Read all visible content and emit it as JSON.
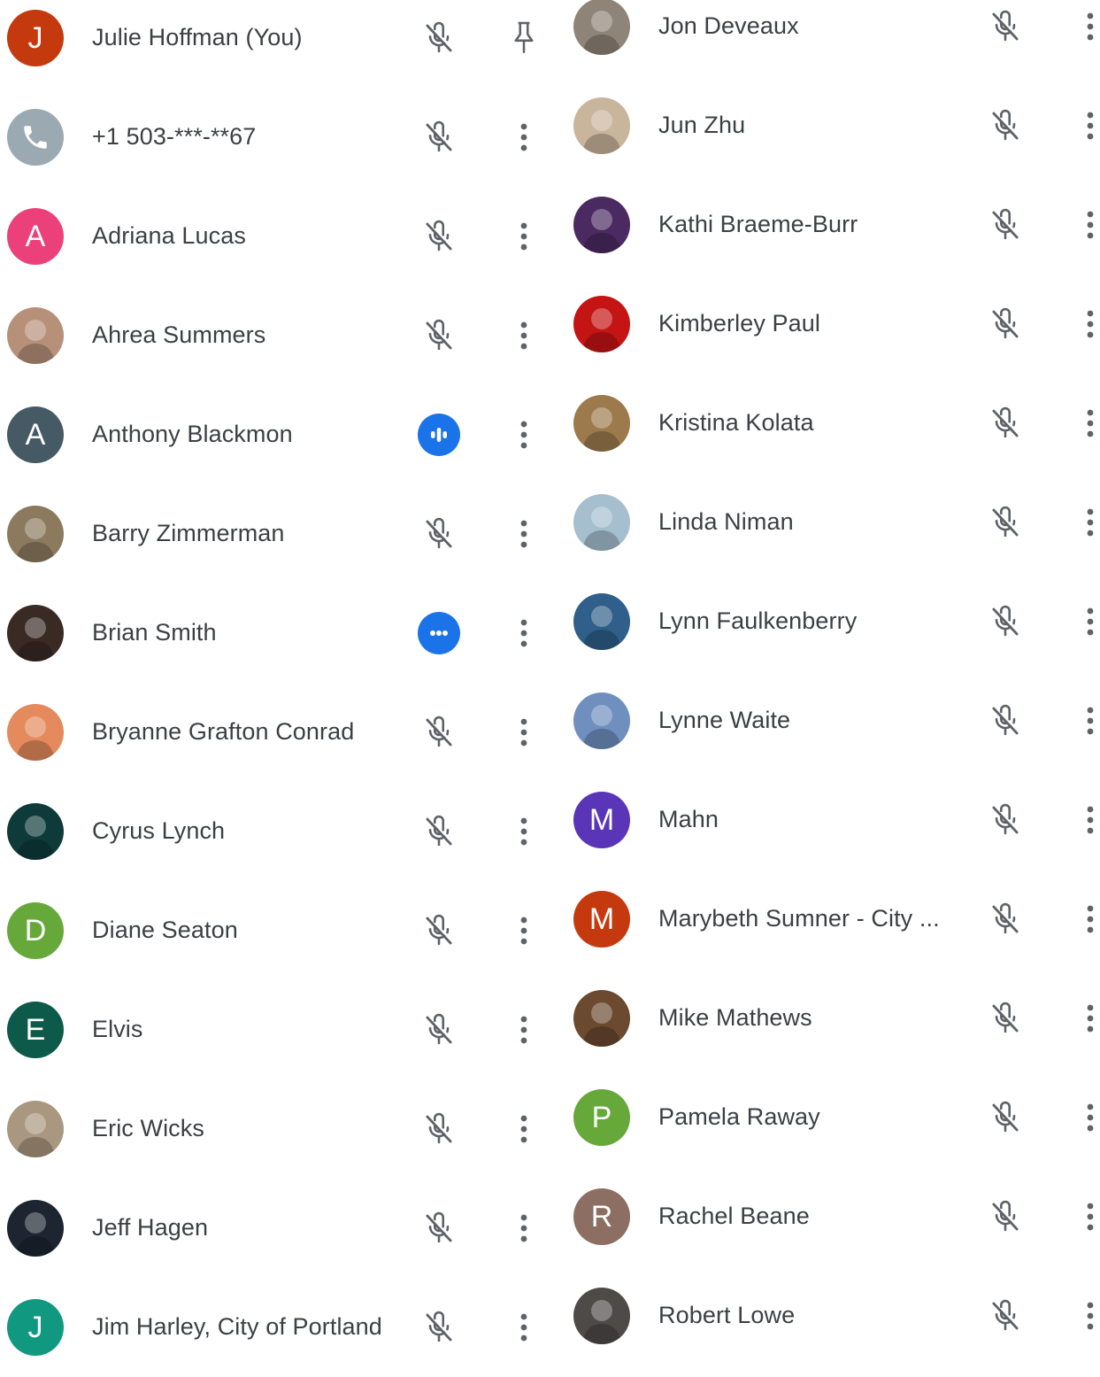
{
  "colors": {
    "text": "#3c4043",
    "icon_gray": "#5f6368",
    "accent_blue": "#1a73e8"
  },
  "participants_left": [
    {
      "name": "Julie Hoffman (You)",
      "avatar": {
        "type": "letter",
        "letter": "J",
        "color": "#c5390f"
      },
      "status": "muted",
      "action": "pin-icon"
    },
    {
      "name": "+1 503-***-**67",
      "avatar": {
        "type": "icon",
        "icon": "phone-icon",
        "color": "#9aa9b2"
      },
      "status": "muted",
      "action": "more-icon"
    },
    {
      "name": "Adriana Lucas",
      "avatar": {
        "type": "letter",
        "letter": "A",
        "color": "#ec407a"
      },
      "status": "muted",
      "action": "more-icon"
    },
    {
      "name": "Ahrea Summers",
      "avatar": {
        "type": "photo",
        "color": "#b7907a"
      },
      "status": "muted",
      "action": "more-icon"
    },
    {
      "name": "Anthony Blackmon",
      "avatar": {
        "type": "letter",
        "letter": "A",
        "color": "#455a64"
      },
      "status": "speaking",
      "action": "more-icon"
    },
    {
      "name": "Barry Zimmerman",
      "avatar": {
        "type": "photo",
        "color": "#8c7a5e"
      },
      "status": "muted",
      "action": "more-icon"
    },
    {
      "name": "Brian Smith",
      "avatar": {
        "type": "photo",
        "color": "#3a2a24"
      },
      "status": "ellipsis",
      "action": "more-icon"
    },
    {
      "name": "Bryanne Grafton Conrad",
      "avatar": {
        "type": "photo",
        "color": "#e48a5c"
      },
      "status": "muted",
      "action": "more-icon"
    },
    {
      "name": "Cyrus Lynch",
      "avatar": {
        "type": "photo",
        "color": "#0e3a3a"
      },
      "status": "muted",
      "action": "more-icon"
    },
    {
      "name": "Diane Seaton",
      "avatar": {
        "type": "letter",
        "letter": "D",
        "color": "#66a83a"
      },
      "status": "muted",
      "action": "more-icon"
    },
    {
      "name": "Elvis",
      "avatar": {
        "type": "letter",
        "letter": "E",
        "color": "#0d5a4a"
      },
      "status": "muted",
      "action": "more-icon"
    },
    {
      "name": "Eric Wicks",
      "avatar": {
        "type": "photo",
        "color": "#a9977f"
      },
      "status": "muted",
      "action": "more-icon"
    },
    {
      "name": "Jeff Hagen",
      "avatar": {
        "type": "photo",
        "color": "#1c2530"
      },
      "status": "muted",
      "action": "more-icon"
    },
    {
      "name": "Jim Harley, City of Portland",
      "avatar": {
        "type": "letter",
        "letter": "J",
        "color": "#109880"
      },
      "status": "muted",
      "action": "more-icon"
    }
  ],
  "participants_right": [
    {
      "name": "Jon Deveaux",
      "avatar": {
        "type": "photo",
        "color": "#8f8478"
      },
      "status": "muted",
      "action": "more-icon"
    },
    {
      "name": "Jun Zhu",
      "avatar": {
        "type": "photo",
        "color": "#c9b49c"
      },
      "status": "muted",
      "action": "more-icon"
    },
    {
      "name": "Kathi Braeme-Burr",
      "avatar": {
        "type": "photo",
        "color": "#4b2a62"
      },
      "status": "muted",
      "action": "more-icon"
    },
    {
      "name": "Kimberley Paul",
      "avatar": {
        "type": "photo",
        "color": "#c41414"
      },
      "status": "muted",
      "action": "more-icon"
    },
    {
      "name": "Kristina Kolata",
      "avatar": {
        "type": "photo",
        "color": "#9c7a4c"
      },
      "status": "muted",
      "action": "more-icon"
    },
    {
      "name": "Linda Niman",
      "avatar": {
        "type": "photo",
        "color": "#a5bfcf"
      },
      "status": "muted",
      "action": "more-icon"
    },
    {
      "name": "Lynn Faulkenberry",
      "avatar": {
        "type": "photo",
        "color": "#2f5f8a"
      },
      "status": "muted",
      "action": "more-icon"
    },
    {
      "name": "Lynne Waite",
      "avatar": {
        "type": "photo",
        "color": "#6f8fbf"
      },
      "status": "muted",
      "action": "more-icon"
    },
    {
      "name": "Mahn",
      "avatar": {
        "type": "letter",
        "letter": "M",
        "color": "#5a35b8"
      },
      "status": "muted",
      "action": "more-icon"
    },
    {
      "name": "Marybeth Sumner - City ...",
      "avatar": {
        "type": "letter",
        "letter": "M",
        "color": "#c5390f"
      },
      "status": "muted",
      "action": "more-icon"
    },
    {
      "name": "Mike Mathews",
      "avatar": {
        "type": "photo",
        "color": "#6b4a30"
      },
      "status": "muted",
      "action": "more-icon"
    },
    {
      "name": "Pamela Raway",
      "avatar": {
        "type": "letter",
        "letter": "P",
        "color": "#66a83a"
      },
      "status": "muted",
      "action": "more-icon"
    },
    {
      "name": "Rachel Beane",
      "avatar": {
        "type": "letter",
        "letter": "R",
        "color": "#8d6e63"
      },
      "status": "muted",
      "action": "more-icon"
    },
    {
      "name": "Robert Lowe",
      "avatar": {
        "type": "photo",
        "color": "#4e4a48"
      },
      "status": "muted",
      "action": "more-icon"
    }
  ]
}
